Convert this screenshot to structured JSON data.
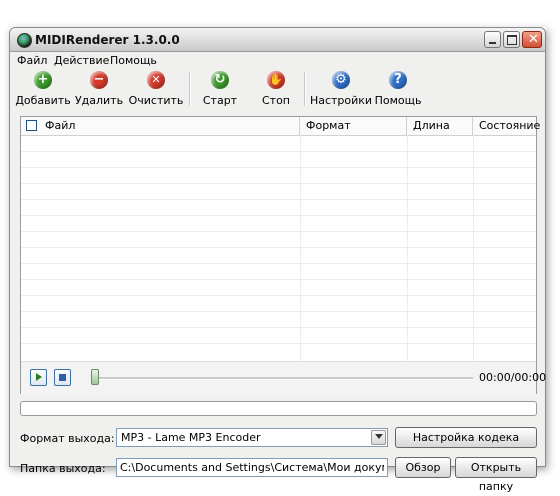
{
  "window": {
    "title": "MIDIRenderer 1.3.0.0"
  },
  "menu": [
    "Файл",
    "Действие",
    "Помощь"
  ],
  "toolbar": [
    {
      "label": "Добавить",
      "icon": "add-icon",
      "color": "#3c9a2a",
      "glyph": "+"
    },
    {
      "label": "Удалить",
      "icon": "remove-icon",
      "color": "#d23a2a",
      "glyph": "−"
    },
    {
      "label": "Очистить",
      "icon": "clear-icon",
      "color": "#d23a2a",
      "glyph": "✕"
    },
    {
      "label": "Старт",
      "icon": "start-icon",
      "color": "#3c9a2a",
      "glyph": "↻"
    },
    {
      "label": "Стоп",
      "icon": "stop-icon",
      "color": "#d23a2a",
      "glyph": "✋"
    },
    {
      "label": "Настройки",
      "icon": "settings-icon",
      "color": "#2e6fc7",
      "glyph": "⚙"
    },
    {
      "label": "Помощь",
      "icon": "help-icon",
      "color": "#2e6fc7",
      "glyph": "?"
    }
  ],
  "table": {
    "columns": [
      "Файл",
      "Формат",
      "Длина",
      "Состояние"
    ],
    "rows": []
  },
  "player": {
    "time": "00:00/00:00",
    "position": 0
  },
  "output": {
    "format_label": "Формат выхода:",
    "format_value": "MP3 - Lame MP3 Encoder",
    "codec_button": "Настройка кодека",
    "folder_label": "Папка выхода:",
    "folder_value": "C:\\Documents and Settings\\Система\\Мои документы\\Моя",
    "browse_button": "Обзор",
    "open_button": "Открыть папку"
  }
}
